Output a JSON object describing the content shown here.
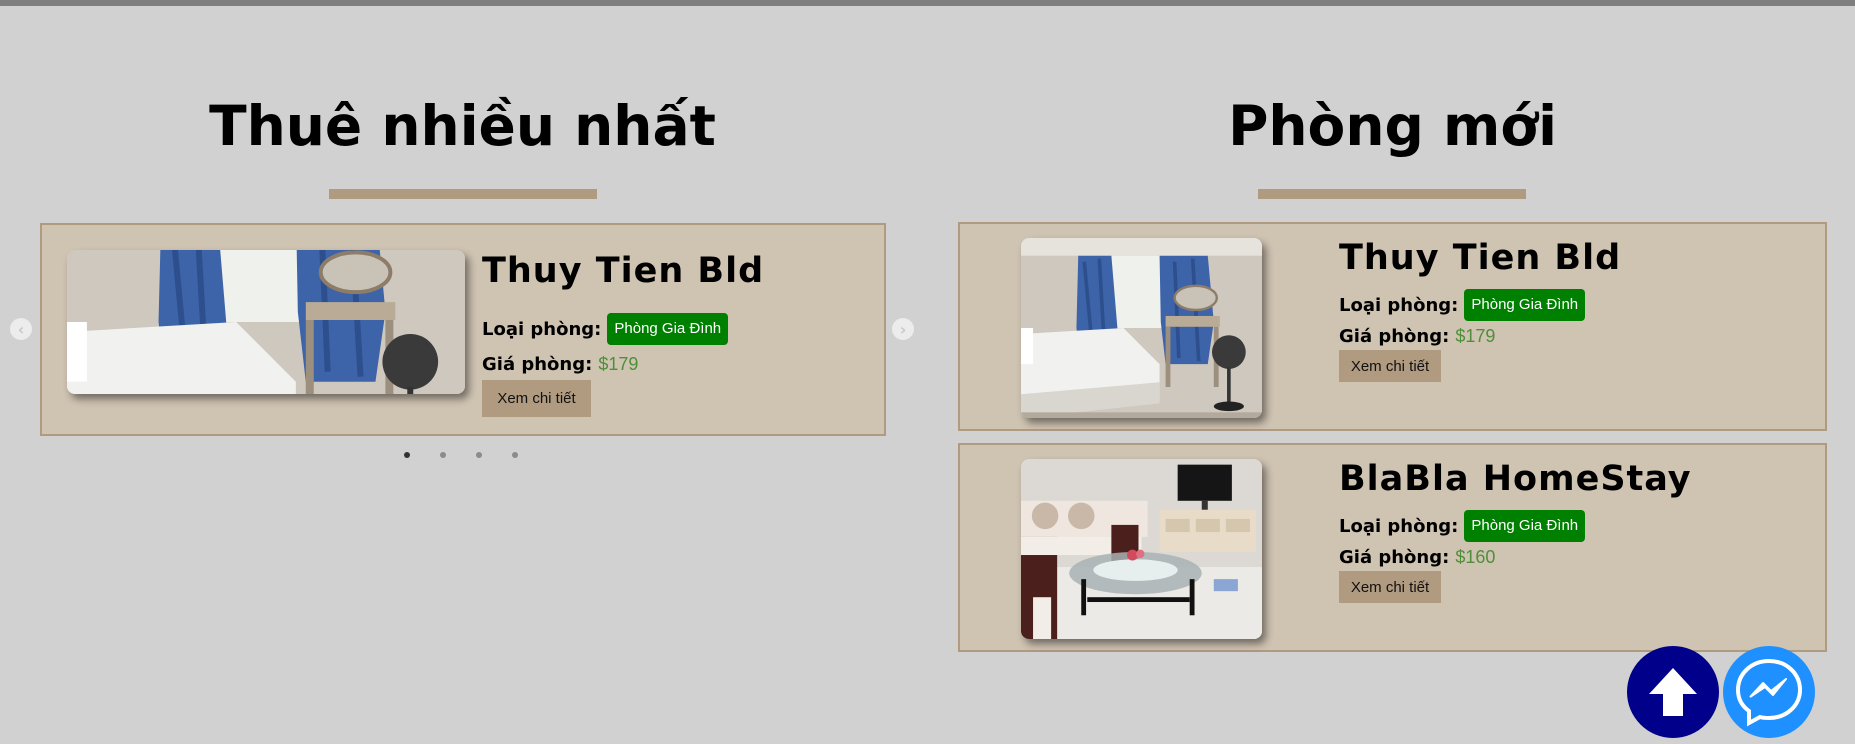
{
  "sections": {
    "most_rented": {
      "title": "Thuê nhiều nhất"
    },
    "new_rooms": {
      "title": "Phòng mới"
    }
  },
  "carousel": {
    "room": {
      "name": "Thuy Tien Bld",
      "type_label": "Loại phòng:",
      "type": "Phòng Gia Đình",
      "price_label": "Giá phòng:",
      "price": "$179",
      "details_button": "Xem chi tiết"
    },
    "prev_arrow": "‹",
    "next_arrow": "›",
    "slide_count": 4,
    "active_slide": 1
  },
  "new_rooms": [
    {
      "name": "Thuy Tien Bld",
      "type_label": "Loại phòng:",
      "type": "Phòng Gia Đình",
      "price_label": "Giá phòng:",
      "price": "$179",
      "details_button": "Xem chi tiết",
      "image": "bedroom-photo"
    },
    {
      "name": "BlaBla HomeStay",
      "type_label": "Loại phòng:",
      "type": "Phòng Gia Đình",
      "price_label": "Giá phòng:",
      "price": "$160",
      "details_button": "Xem chi tiết",
      "image": "living-room-photo"
    }
  ],
  "floating_buttons": {
    "scroll_top": {
      "icon": "arrow-up-icon",
      "color": "#00008b"
    },
    "messenger": {
      "icon": "messenger-icon",
      "color": "#1e90ff"
    }
  },
  "colors": {
    "accent": "#b09a80",
    "card_bg": "#cfc3b2",
    "badge_green": "#008000",
    "price_green": "#4e8f3a",
    "page_bg": "#d1d1d1"
  }
}
